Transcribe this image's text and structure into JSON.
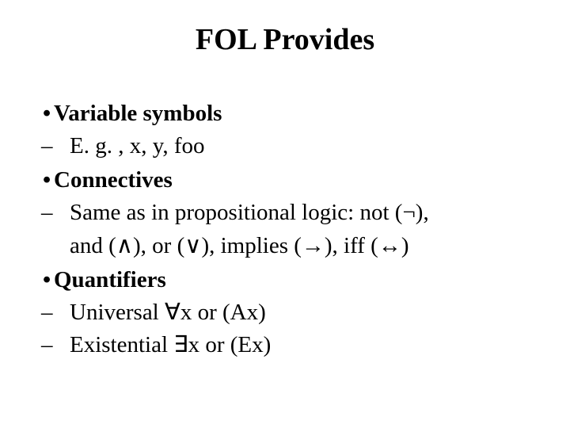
{
  "title": "FOL Provides",
  "items": {
    "vars": {
      "label": "Variable symbols",
      "sub": "E. g. , x, y, foo"
    },
    "conn": {
      "label": "Connectives",
      "sub1": "Same as in propositional logic: not (¬),",
      "sub2": "and (∧), or (∨), implies (→), iff (↔)"
    },
    "quant": {
      "label": "Quantifiers",
      "sub1": "Universal ∀x or  (Ax)",
      "sub2": "Existential ∃x or (Ex)"
    }
  },
  "markers": {
    "bullet": "•",
    "dash": "–"
  }
}
